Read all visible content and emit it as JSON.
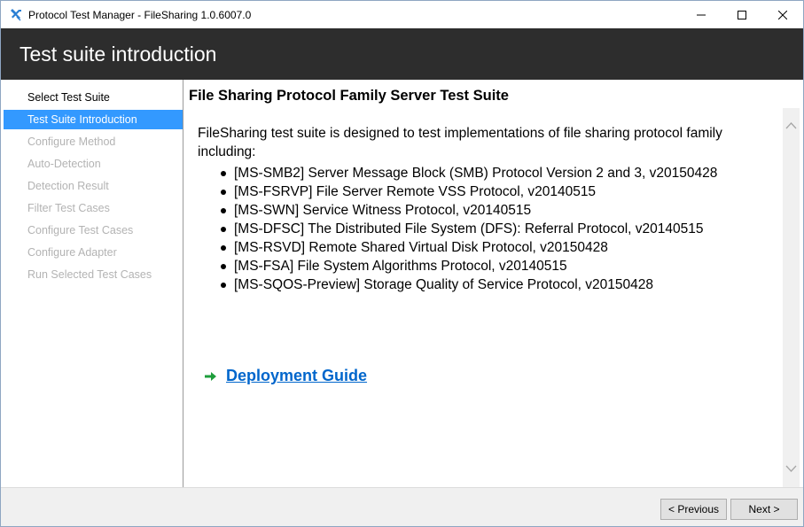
{
  "window": {
    "title": "Protocol Test Manager - FileSharing 1.0.6007.0",
    "icons": {
      "app": "tools-icon",
      "minimize": "minimize-icon",
      "maximize": "maximize-icon",
      "close": "close-icon"
    }
  },
  "header": {
    "title": "Test suite introduction"
  },
  "sidebar": {
    "items": [
      {
        "label": "Select Test Suite",
        "state": "done"
      },
      {
        "label": "Test Suite Introduction",
        "state": "active"
      },
      {
        "label": "Configure Method",
        "state": "disabled"
      },
      {
        "label": "Auto-Detection",
        "state": "disabled"
      },
      {
        "label": "Detection Result",
        "state": "disabled"
      },
      {
        "label": "Filter Test Cases",
        "state": "disabled"
      },
      {
        "label": "Configure Test Cases",
        "state": "disabled"
      },
      {
        "label": "Configure Adapter",
        "state": "disabled"
      },
      {
        "label": "Run Selected Test Cases",
        "state": "disabled"
      }
    ]
  },
  "main": {
    "suite_title": "File Sharing Protocol Family Server Test Suite",
    "intro": "FileSharing test suite is designed to test implementations of file sharing protocol family including:",
    "protocols": [
      "[MS-SMB2] Server Message Block (SMB) Protocol Version 2 and 3, v20150428",
      "[MS-FSRVP] File Server Remote VSS Protocol, v20140515",
      "[MS-SWN] Service Witness Protocol, v20140515",
      "[MS-DFSC] The Distributed File System (DFS): Referral Protocol, v20140515",
      "[MS-RSVD] Remote Shared Virtual Disk Protocol, v20150428",
      "[MS-FSA] File System Algorithms Protocol, v20140515",
      "[MS-SQOS-Preview] Storage Quality of Service Protocol, v20150428"
    ],
    "deployment_link": "Deployment Guide"
  },
  "footer": {
    "previous_label": "< Previous",
    "next_label": "Next >"
  },
  "colors": {
    "header_bg": "#2d2d2d",
    "active_item_bg": "#3399ff",
    "disabled_text": "#b3b3b3",
    "link": "#0066cc",
    "arrow": "#1e9e3c"
  }
}
